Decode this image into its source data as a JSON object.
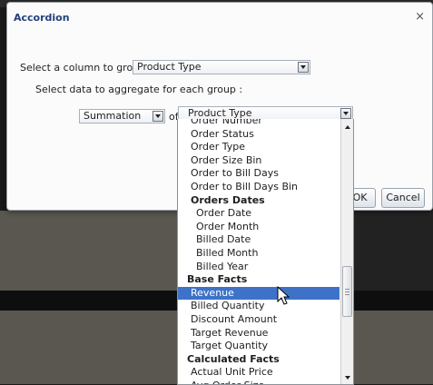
{
  "dialog": {
    "title": "Accordion",
    "close_glyph": "×",
    "group_label": "Select a column to group :",
    "group_value": "Product Type",
    "aggregate_label": "Select data to aggregate for each group :",
    "function_value": "Summation",
    "of_label": "of",
    "column_value": "Product Type",
    "ok_label": "OK",
    "cancel_label": "Cancel"
  },
  "dropdown": {
    "items": [
      {
        "label": "Order Number",
        "kind": "item"
      },
      {
        "label": "Order Status",
        "kind": "item"
      },
      {
        "label": "Order Type",
        "kind": "item"
      },
      {
        "label": "Order Size Bin",
        "kind": "item"
      },
      {
        "label": "Order to Bill Days",
        "kind": "item"
      },
      {
        "label": "Order to Bill Days Bin",
        "kind": "item"
      },
      {
        "label": "Orders Dates",
        "kind": "group"
      },
      {
        "label": "Order Date",
        "kind": "sub"
      },
      {
        "label": "Order Month",
        "kind": "sub"
      },
      {
        "label": "Billed Date",
        "kind": "sub"
      },
      {
        "label": "Billed Month",
        "kind": "sub"
      },
      {
        "label": "Billed Year",
        "kind": "sub"
      },
      {
        "label": "Base Facts",
        "kind": "top"
      },
      {
        "label": "Revenue",
        "kind": "base",
        "selected": true
      },
      {
        "label": "Billed Quantity",
        "kind": "base"
      },
      {
        "label": "Discount Amount",
        "kind": "base"
      },
      {
        "label": "Target Revenue",
        "kind": "base"
      },
      {
        "label": "Target Quantity",
        "kind": "base"
      },
      {
        "label": "Calculated Facts",
        "kind": "top"
      },
      {
        "label": "Actual Unit Price",
        "kind": "base"
      },
      {
        "label": "Avg Order Size",
        "kind": "base"
      }
    ]
  },
  "icons": {
    "close": "close-icon",
    "dropdown": "chevron-down-icon",
    "scroll_up": "scroll-up-icon",
    "scroll_down": "scroll-down-icon",
    "cursor": "mouse-pointer-icon"
  },
  "colors": {
    "title": "#23407a",
    "selection": "#3d72c7"
  }
}
